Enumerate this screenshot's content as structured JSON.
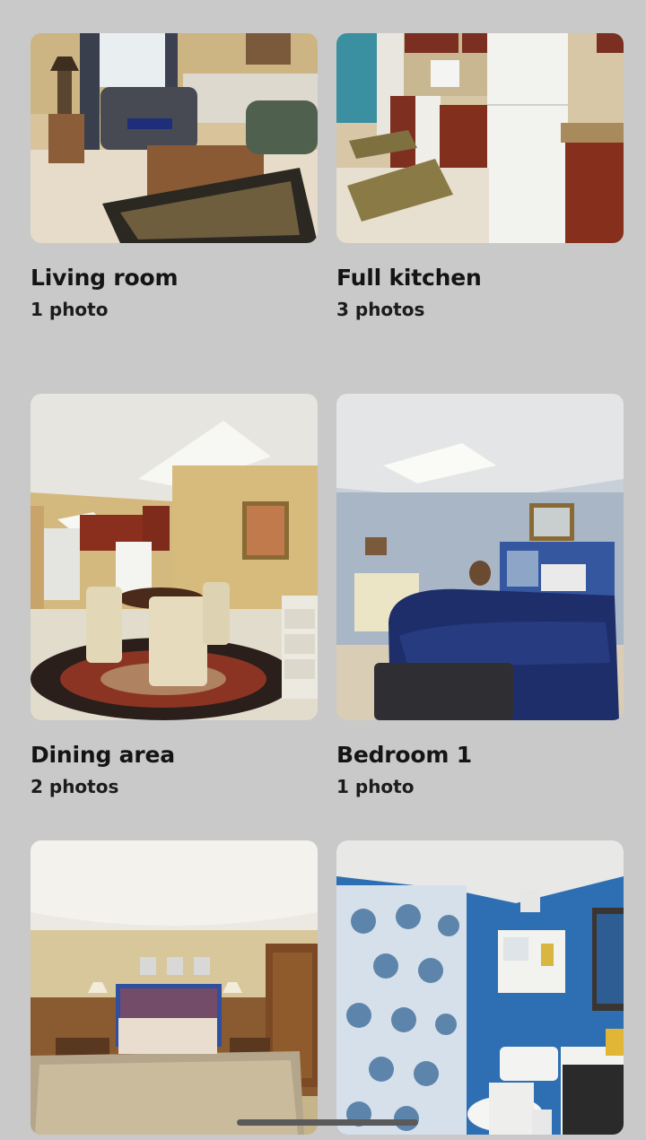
{
  "rooms": [
    {
      "title": "Living room",
      "count": "1 photo",
      "image": "living-room-photo"
    },
    {
      "title": "Full kitchen",
      "count": "3 photos",
      "image": "kitchen-photo"
    },
    {
      "title": "Dining area",
      "count": "2 photos",
      "image": "dining-area-photo"
    },
    {
      "title": "Bedroom 1",
      "count": "1 photo",
      "image": "bedroom-1-photo"
    },
    {
      "title": "",
      "count": "",
      "image": "bedroom-2-photo"
    },
    {
      "title": "",
      "count": "",
      "image": "bathroom-photo"
    }
  ],
  "colors": {
    "background": "#c9c9c9",
    "title_text": "#141414",
    "home_indicator": "#5a5a5a"
  }
}
